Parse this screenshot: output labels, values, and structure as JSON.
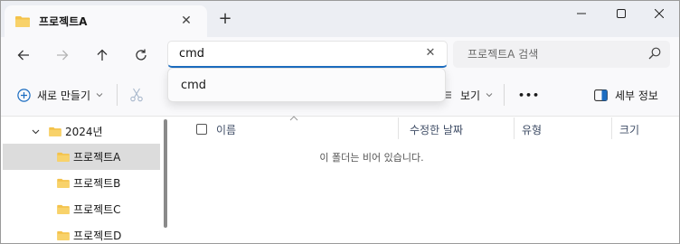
{
  "tab": {
    "title": "프로젝트A",
    "close": "✕",
    "new_tab": "+"
  },
  "window": {
    "minimize": "—",
    "maximize": "☐",
    "close": "✕"
  },
  "address": {
    "value": "cmd",
    "clear": "✕"
  },
  "search": {
    "placeholder": "프로젝트A 검색"
  },
  "autocomplete": {
    "items": [
      "cmd"
    ]
  },
  "toolbar": {
    "new_label": "새로 만들기",
    "view_label": "보기",
    "more_label": "•••",
    "details_label": "세부 정보"
  },
  "sidebar": {
    "items": [
      {
        "label": "2024년"
      },
      {
        "label": "프로젝트A"
      },
      {
        "label": "프로젝트B"
      },
      {
        "label": "프로젝트C"
      },
      {
        "label": "프로젝트D"
      }
    ]
  },
  "columns": {
    "name": "이름",
    "modified": "수정한 날짜",
    "type": "유형",
    "size": "크기"
  },
  "empty_message": "이 폴더는 비어 있습니다.",
  "colors": {
    "accent": "#1c6dc1",
    "folder": "#f4c24a",
    "selected": "#dcdcdc"
  }
}
